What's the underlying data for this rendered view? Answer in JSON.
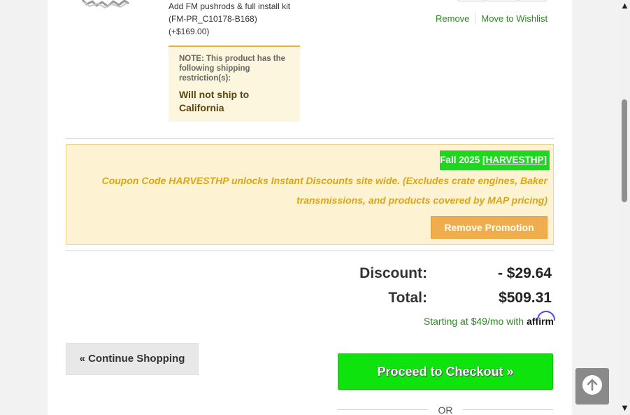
{
  "product": {
    "option_line1": "Add FM pushrods & full install kit",
    "option_line2": "(FM-PR_C10178-B168)",
    "option_line3": "(+$169.00)",
    "restriction_note": "NOTE: This product has the following shipping restriction(s):",
    "restriction": "Will not ship to California",
    "remove_label": "Remove",
    "wishlist_label": "Move to Wishlist"
  },
  "promo": {
    "badge_text": "Fall 2025 ",
    "code_link": "[HARVESTHP]",
    "message": "Coupon Code HARVESTHP unlocks Instant Discounts site wide. (Excludes crate engines, Baker transmissions, and products covered by MAP pricing)",
    "remove_label": "Remove Promotion",
    "badge_color": "#1fd620",
    "message_color": "#d9a618",
    "button_color": "#f0ad4e"
  },
  "totals": {
    "discount_label": "Discount:",
    "discount_value": "- $29.64",
    "total_label": "Total:",
    "total_value": "$509.31",
    "financing_text": "Starting at $49/mo with",
    "financing_brand": "affirm"
  },
  "actions": {
    "continue_label": "« Continue Shopping",
    "checkout_label": "Proceed to Checkout »",
    "or_text": "OR",
    "checkout_color": "#0ee30e"
  },
  "icons": {
    "back_to_top": "arrow-up-icon",
    "scroll_up": "scroll-up-arrow",
    "scroll_down": "scroll-down-arrow"
  }
}
